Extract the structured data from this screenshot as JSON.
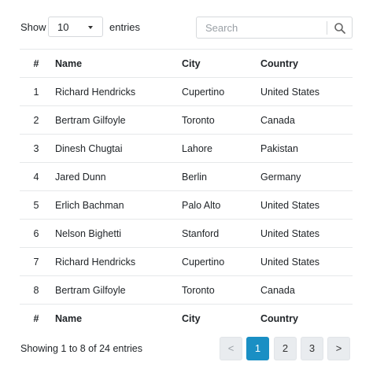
{
  "length_control": {
    "label_before": "Show",
    "selected": "10",
    "label_after": "entries"
  },
  "search": {
    "placeholder": "Search",
    "value": ""
  },
  "table": {
    "headers": [
      "#",
      "Name",
      "City",
      "Country"
    ],
    "rows": [
      [
        "1",
        "Richard Hendricks",
        "Cupertino",
        "United States"
      ],
      [
        "2",
        "Bertram Gilfoyle",
        "Toronto",
        "Canada"
      ],
      [
        "3",
        "Dinesh Chugtai",
        "Lahore",
        "Pakistan"
      ],
      [
        "4",
        "Jared Dunn",
        "Berlin",
        "Germany"
      ],
      [
        "5",
        "Erlich Bachman",
        "Palo Alto",
        "United States"
      ],
      [
        "6",
        "Nelson Bighetti",
        "Stanford",
        "United States"
      ],
      [
        "7",
        "Richard Hendricks",
        "Cupertino",
        "United States"
      ],
      [
        "8",
        "Bertram Gilfoyle",
        "Toronto",
        "Canada"
      ]
    ],
    "footers": [
      "#",
      "Name",
      "City",
      "Country"
    ]
  },
  "info": "Showing 1 to 8 of 24 entries",
  "pagination": {
    "prev": "<",
    "pages": [
      "1",
      "2",
      "3"
    ],
    "current": "1",
    "next": ">"
  },
  "colors": {
    "accent": "#1a8fc4",
    "button_bg": "#e9ecef",
    "border": "#e6e8ea"
  }
}
